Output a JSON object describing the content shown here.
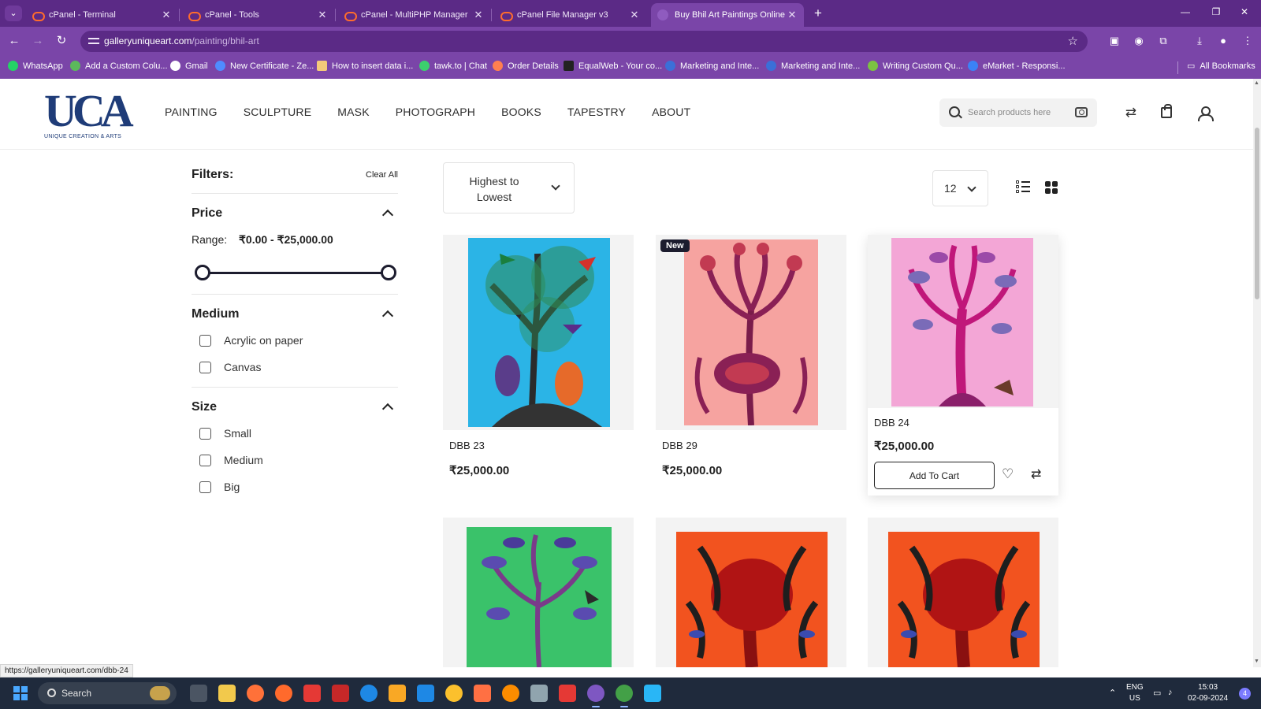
{
  "browser": {
    "tabs": [
      {
        "title": "cPanel - Terminal",
        "favicon": "cpanel-icon"
      },
      {
        "title": "cPanel - Tools",
        "favicon": "cpanel-icon"
      },
      {
        "title": "cPanel - MultiPHP Manager",
        "favicon": "cpanel-icon"
      },
      {
        "title": "cPanel File Manager v3",
        "favicon": "cpanel-icon"
      },
      {
        "title": "Buy Bhil Art Paintings Online | C",
        "favicon": "gallery-icon",
        "active": true
      }
    ],
    "url_domain": "galleryuniqueart.com",
    "url_path": "/painting/bhil-art",
    "bookmarks": [
      {
        "label": "WhatsApp",
        "color": "#25d366"
      },
      {
        "label": "Add a Custom Colu...",
        "color": "#5cb85c"
      },
      {
        "label": "Gmail",
        "color": "#ffffff"
      },
      {
        "label": "New Certificate - Ze...",
        "color": "#4f8cff"
      },
      {
        "label": "How to insert data i...",
        "color": "#f4c97a"
      },
      {
        "label": "tawk.to | Chat",
        "color": "#3ccf6e"
      },
      {
        "label": "Order Details",
        "color": "#ff7f50"
      },
      {
        "label": "EqualWeb - Your co...",
        "color": "#222222"
      },
      {
        "label": "Marketing and Inte...",
        "color": "#3b6fd8"
      },
      {
        "label": "Marketing and Inte...",
        "color": "#3b6fd8"
      },
      {
        "label": "Writing Custom Qu...",
        "color": "#7cc242"
      },
      {
        "label": "eMarket - Responsi...",
        "color": "#3b82f6"
      }
    ],
    "all_bookmarks": "All Bookmarks",
    "status_url": "https://galleryuniqueart.com/dbb-24"
  },
  "site": {
    "logo_mark": "UCA",
    "logo_tag": "UNIQUE CREATION & ARTS",
    "brand_color": "#1f3c78",
    "nav": [
      "PAINTING",
      "SCULPTURE",
      "MASK",
      "PHOTOGRAPH",
      "BOOKS",
      "TAPESTRY",
      "ABOUT"
    ],
    "search_placeholder": "Search products here"
  },
  "filters": {
    "title": "Filters:",
    "clear_all": "Clear All",
    "price": {
      "title": "Price",
      "range_label": "Range:",
      "range_value": "₹0.00 - ₹25,000.00"
    },
    "medium": {
      "title": "Medium",
      "options": [
        "Acrylic on paper",
        "Canvas"
      ]
    },
    "size": {
      "title": "Size",
      "options": [
        "Small",
        "Medium",
        "Big"
      ]
    }
  },
  "listing": {
    "sort_value": "Highest to Lowest",
    "per_page": "12",
    "products": [
      {
        "name": "DBB 23",
        "price": "₹25,000.00"
      },
      {
        "name": "DBB 29",
        "price": "₹25,000.00",
        "badge": "New"
      },
      {
        "name": "DBB 24",
        "price": "₹25,000.00",
        "add_to_cart": "Add To Cart"
      }
    ]
  },
  "taskbar": {
    "search": "Search",
    "lang_top": "ENG",
    "lang_bottom": "US",
    "time": "15:03",
    "date": "02-09-2024",
    "notifications": "4"
  }
}
